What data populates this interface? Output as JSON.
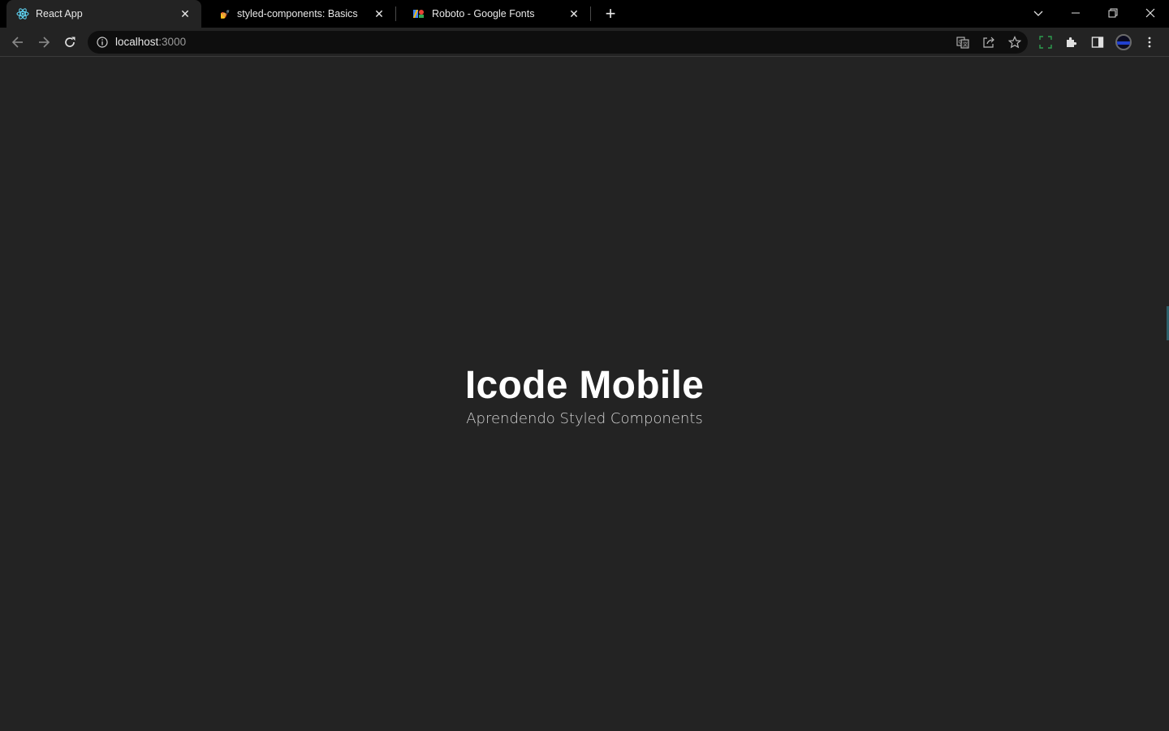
{
  "browser": {
    "tabs": [
      {
        "title": "React App",
        "icon": "react-icon",
        "active": true
      },
      {
        "title": "styled-components: Basics",
        "icon": "styled-components-icon",
        "active": false
      },
      {
        "title": "Roboto - Google Fonts",
        "icon": "google-fonts-icon",
        "active": false
      }
    ],
    "address": {
      "host": "localhost",
      "port": ":3000"
    }
  },
  "page": {
    "title": "Icode Mobile",
    "subtitle": "Aprendendo Styled Components"
  },
  "colors": {
    "page_background": "#232323",
    "chrome_background": "#000000",
    "heading": "#ffffff",
    "subheading": "#d2d2d2"
  }
}
